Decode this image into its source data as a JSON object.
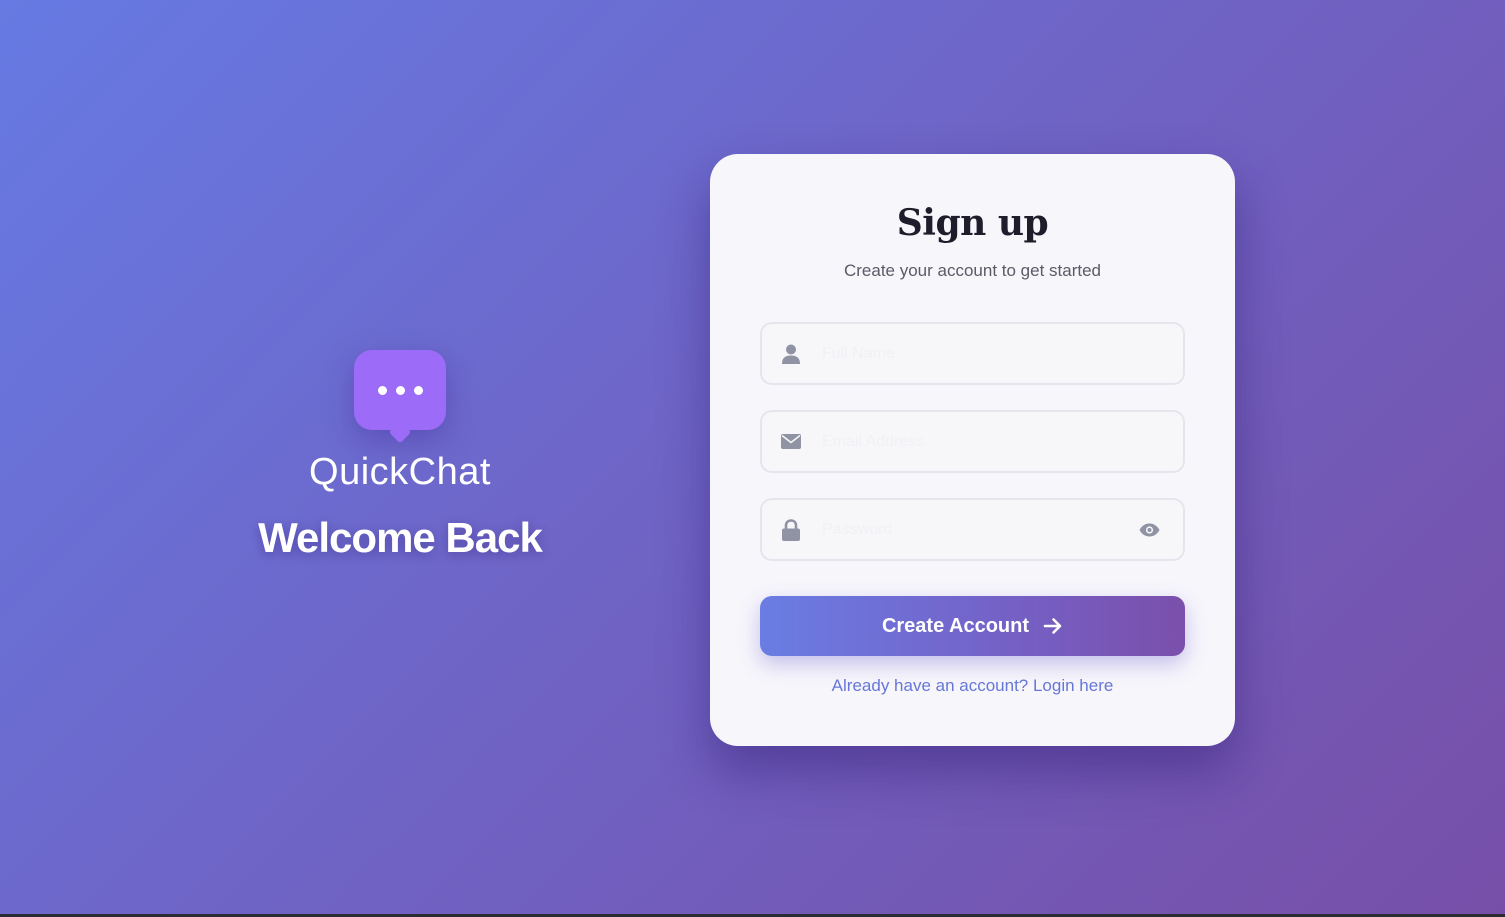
{
  "brand": {
    "name": "QuickChat",
    "welcome": "Welcome Back",
    "logo_icon": "chat-bubble-icon"
  },
  "form": {
    "title": "Sign up",
    "subtitle": "Create your account to get started",
    "fields": {
      "name": {
        "placeholder": "Full Name",
        "value": "",
        "icon": "user-icon"
      },
      "email": {
        "placeholder": "Email Address",
        "value": "",
        "icon": "envelope-icon"
      },
      "password": {
        "placeholder": "Password",
        "value": "",
        "icon": "lock-icon",
        "toggle_icon": "eye-icon"
      }
    },
    "submit_label": "Create Account",
    "submit_icon": "arrow-right-icon",
    "login_text": "Already have an account? Login here"
  },
  "colors": {
    "background_start": "#667ae3",
    "background_end": "#774fa8",
    "logo": "#9c6cf9",
    "link": "#6677d8",
    "card": "#f7f6fb"
  }
}
